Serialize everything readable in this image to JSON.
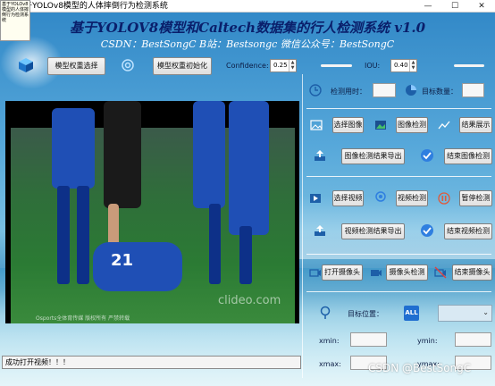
{
  "window": {
    "title": "基于YOLOv8模型的人体摔倒行为检测系统",
    "tooltip": "基于YOLOv8模型的人体摔倒行为检测系统",
    "controls": {
      "minimize": "—",
      "maximize": "☐",
      "close": "✕"
    }
  },
  "header": {
    "title": "基于YOLOV8模型和Caltech数据集的行人检测系统 v1.0",
    "subtitle": "CSDN：BestSongC   B站：Bestsongc   微信公众号：BestSongC"
  },
  "toolbar": {
    "select_weights_label": "模型权重选择",
    "init_weights_label": "模型权重初始化",
    "confidence_label": "Confidence:",
    "confidence_value": "0.25",
    "iou_label": "IOU:",
    "iou_value": "0.40",
    "confidence_slider_level": 0.25,
    "iou_slider_level": 0.4
  },
  "stats": {
    "time_label": "检测用时：",
    "time_value": "",
    "count_label": "目标数量：",
    "count_value": ""
  },
  "image_section": {
    "select_image": "选择图像",
    "detect_image": "图像检测",
    "show_result": "结果展示",
    "export_image": "图像检测结果导出",
    "stop_image": "结束图像检测"
  },
  "video_section": {
    "select_video": "选择视频",
    "detect_video": "视频检测",
    "pause_detect": "暂停检测",
    "export_video": "视频检测结果导出",
    "stop_video": "结束视频检测"
  },
  "camera_section": {
    "open_camera": "打开摄像头",
    "camera_detect": "摄像头检测",
    "stop_camera": "结束摄像头"
  },
  "target": {
    "position_label": "目标位置：",
    "all_icon_text": "ALL",
    "select_value": "",
    "xmin_label": "xmin:",
    "ymin_label": "ymin:",
    "xmax_label": "xmax:",
    "ymax_label": "ymax:",
    "xmin_value": "",
    "ymin_value": "",
    "xmax_value": "",
    "ymax_value": ""
  },
  "video_frame": {
    "jersey_number": "21",
    "watermark": "clideo.com",
    "channel": "Osports全体育传媒 版权所有 严禁转载"
  },
  "status_bar": {
    "message": "成功打开视频！！！"
  },
  "csdn_watermark": "CSDN @BestSongC",
  "icons": [
    "cube-icon",
    "settings-icon",
    "clock-icon",
    "pie-chart-icon",
    "image-icon",
    "picture-icon",
    "line-chart-icon",
    "upload-icon",
    "check-icon",
    "video-icon",
    "location-icon",
    "pause-icon",
    "camera-icon",
    "camera-off-icon",
    "pin-icon",
    "all-icon"
  ]
}
